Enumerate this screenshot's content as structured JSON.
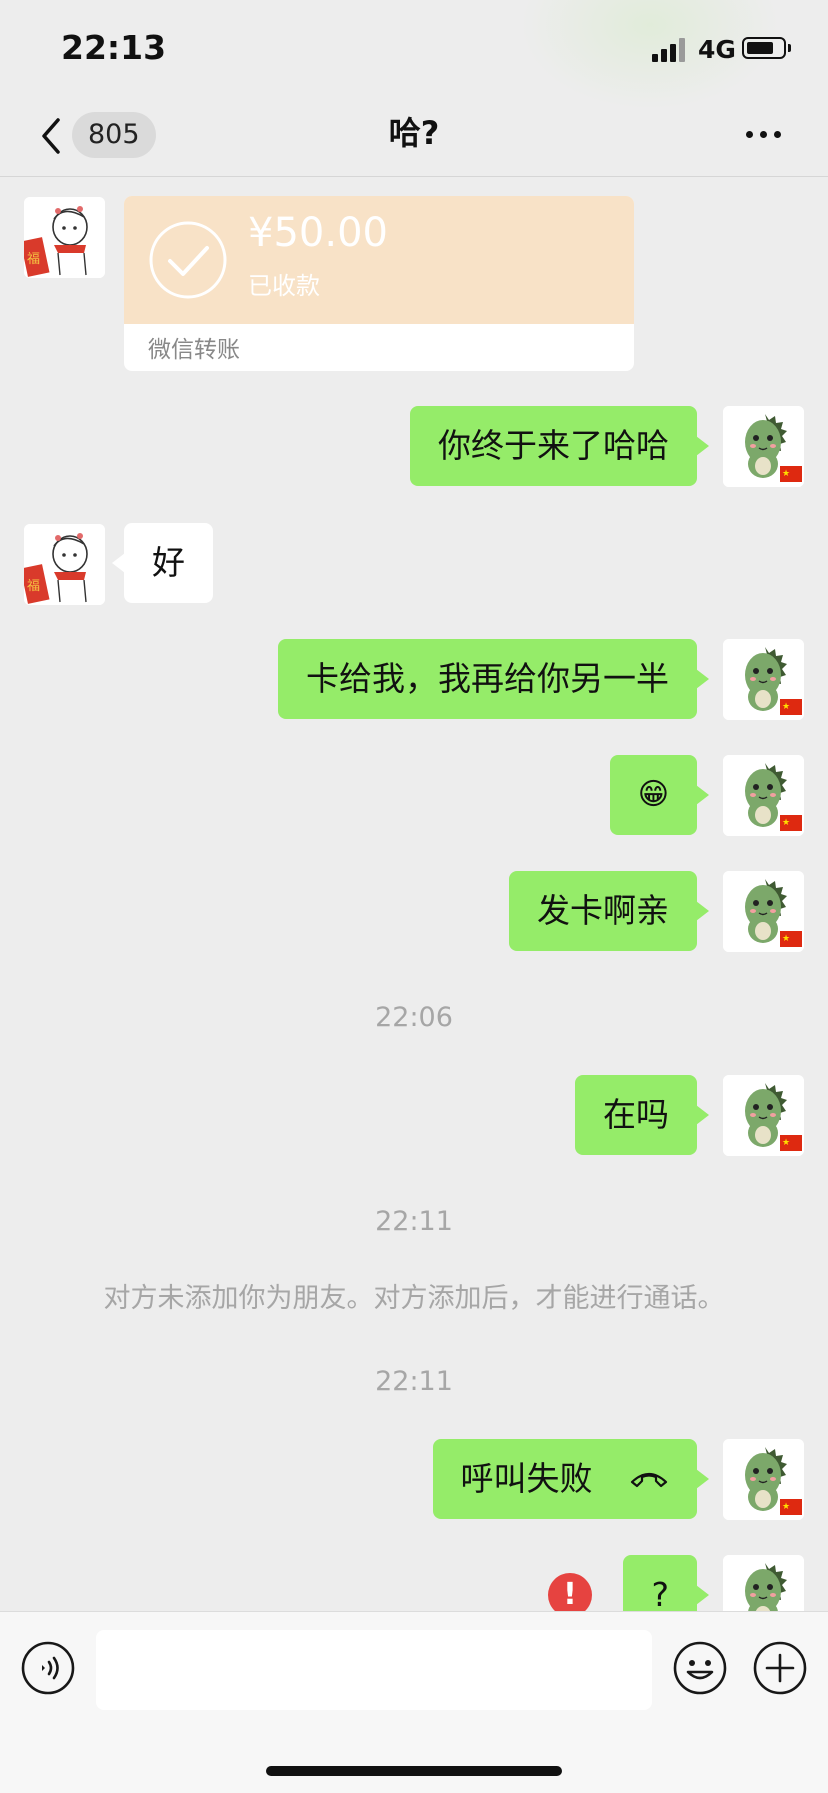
{
  "status_bar": {
    "time": "22:13",
    "network": "4G",
    "battery_level": 0.75
  },
  "nav": {
    "back_count": "805",
    "title": "哈?",
    "more_icon": "more-dots-icon",
    "back_icon": "chevron-left-icon"
  },
  "chat": {
    "transfer": {
      "amount": "¥50.00",
      "status": "已收款",
      "footer": "微信转账",
      "icon": "check-circle-icon"
    },
    "messages": [
      {
        "dir": "out",
        "text": "你终于来了哈哈"
      },
      {
        "dir": "in",
        "text": "好"
      },
      {
        "dir": "out",
        "text": "卡给我，我再给你另一半"
      },
      {
        "dir": "out",
        "text": "😁"
      },
      {
        "dir": "out",
        "text": "发卡啊亲"
      },
      {
        "dir": "out",
        "text": "在吗"
      },
      {
        "dir": "out",
        "text": "呼叫失败"
      },
      {
        "dir": "out",
        "text": "?"
      }
    ],
    "timestamps": [
      "22:06",
      "22:11",
      "22:11"
    ],
    "system_notice": "对方未添加你为朋友。对方添加后，才能进行通话。",
    "error_badge": "!"
  },
  "input_bar": {
    "voice_icon": "voice-icon",
    "emoji_icon": "emoji-icon",
    "plus_icon": "plus-icon",
    "placeholder": ""
  },
  "colors": {
    "background": "#EDEDED",
    "outgoing_bubble": "#95EC69",
    "incoming_bubble": "#FFFFFF",
    "transfer_card": "#F8E2C7",
    "error": "#E64340"
  }
}
